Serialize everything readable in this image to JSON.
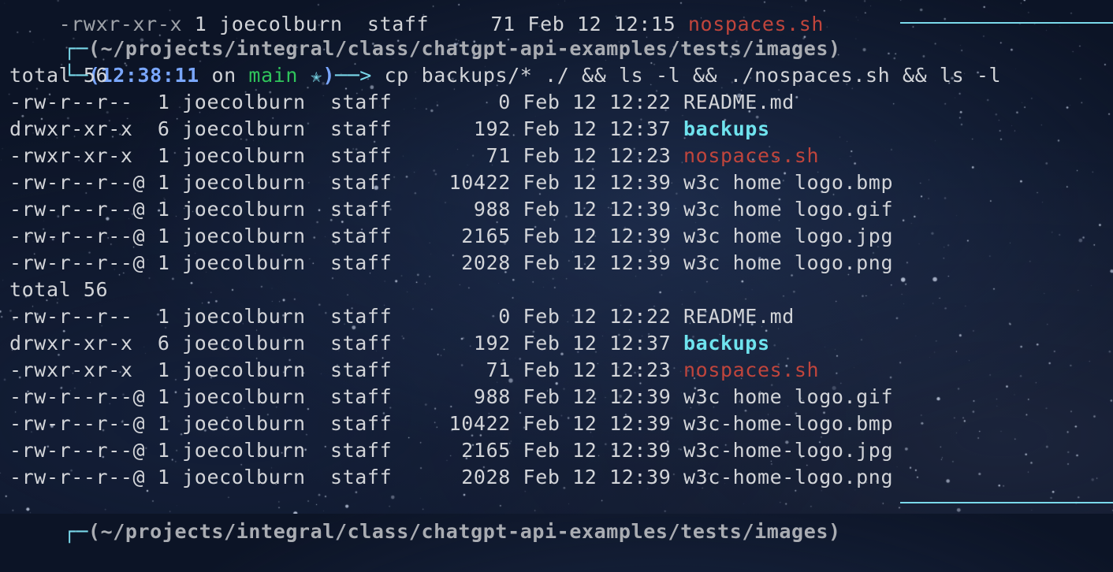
{
  "top_cut_line": {
    "perms": "-rwxr-xr-x",
    "links": "1",
    "owner": "joecolburn",
    "group": "staff",
    "size": "71",
    "date": "Feb 12 12:15",
    "name": "nospaces.sh"
  },
  "prompt": {
    "path": "(~/projects/integral/class/chatgpt-api-examples/tests/images)",
    "time": "12:38:11",
    "on_word": "on",
    "branch": "main",
    "star": "✭",
    "command": "cp backups/* ./ && ls -l && ./nospaces.sh && ls -l"
  },
  "listing_1": {
    "total": "total 56",
    "rows": [
      {
        "perms": "-rw-r--r-- ",
        "links": "1",
        "owner": "joecolburn",
        "group": "staff",
        "size": "0",
        "date": "Feb 12 12:22",
        "name": "README.md",
        "type": "file"
      },
      {
        "perms": "drwxr-xr-x ",
        "links": "6",
        "owner": "joecolburn",
        "group": "staff",
        "size": "192",
        "date": "Feb 12 12:37",
        "name": "backups",
        "type": "dir"
      },
      {
        "perms": "-rwxr-xr-x ",
        "links": "1",
        "owner": "joecolburn",
        "group": "staff",
        "size": "71",
        "date": "Feb 12 12:23",
        "name": "nospaces.sh",
        "type": "exec"
      },
      {
        "perms": "-rw-r--r--@",
        "links": "1",
        "owner": "joecolburn",
        "group": "staff",
        "size": "10422",
        "date": "Feb 12 12:39",
        "name": "w3c home logo.bmp",
        "type": "file"
      },
      {
        "perms": "-rw-r--r--@",
        "links": "1",
        "owner": "joecolburn",
        "group": "staff",
        "size": "988",
        "date": "Feb 12 12:39",
        "name": "w3c home logo.gif",
        "type": "file"
      },
      {
        "perms": "-rw-r--r--@",
        "links": "1",
        "owner": "joecolburn",
        "group": "staff",
        "size": "2165",
        "date": "Feb 12 12:39",
        "name": "w3c home logo.jpg",
        "type": "file"
      },
      {
        "perms": "-rw-r--r--@",
        "links": "1",
        "owner": "joecolburn",
        "group": "staff",
        "size": "2028",
        "date": "Feb 12 12:39",
        "name": "w3c home logo.png",
        "type": "file"
      }
    ]
  },
  "listing_2": {
    "total": "total 56",
    "rows": [
      {
        "perms": "-rw-r--r-- ",
        "links": "1",
        "owner": "joecolburn",
        "group": "staff",
        "size": "0",
        "date": "Feb 12 12:22",
        "name": "README.md",
        "type": "file"
      },
      {
        "perms": "drwxr-xr-x ",
        "links": "6",
        "owner": "joecolburn",
        "group": "staff",
        "size": "192",
        "date": "Feb 12 12:37",
        "name": "backups",
        "type": "dir"
      },
      {
        "perms": "-rwxr-xr-x ",
        "links": "1",
        "owner": "joecolburn",
        "group": "staff",
        "size": "71",
        "date": "Feb 12 12:23",
        "name": "nospaces.sh",
        "type": "exec"
      },
      {
        "perms": "-rw-r--r--@",
        "links": "1",
        "owner": "joecolburn",
        "group": "staff",
        "size": "988",
        "date": "Feb 12 12:39",
        "name": "w3c home logo.gif",
        "type": "file"
      },
      {
        "perms": "-rw-r--r--@",
        "links": "1",
        "owner": "joecolburn",
        "group": "staff",
        "size": "10422",
        "date": "Feb 12 12:39",
        "name": "w3c-home-logo.bmp",
        "type": "file"
      },
      {
        "perms": "-rw-r--r--@",
        "links": "1",
        "owner": "joecolburn",
        "group": "staff",
        "size": "2165",
        "date": "Feb 12 12:39",
        "name": "w3c-home-logo.jpg",
        "type": "file"
      },
      {
        "perms": "-rw-r--r--@",
        "links": "1",
        "owner": "joecolburn",
        "group": "staff",
        "size": "2028",
        "date": "Feb 12 12:39",
        "name": "w3c-home-logo.png",
        "type": "file"
      }
    ]
  },
  "bottom_prompt": {
    "path": "(~/projects/integral/class/chatgpt-api-examples/tests/images)"
  },
  "colors": {
    "background": "#0c1426",
    "text": "#d2d4d8",
    "directory": "#6fe3ee",
    "executable": "#c0453c",
    "branch": "#2fc55b",
    "time": "#7aa7ff",
    "frame": "#7ad9ea"
  }
}
